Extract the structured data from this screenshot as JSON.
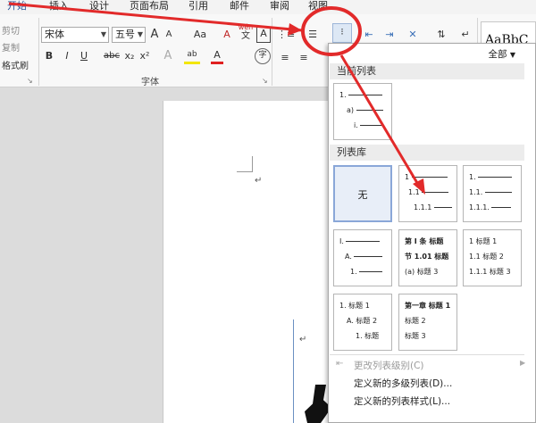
{
  "tabs": [
    "开始",
    "插入",
    "设计",
    "页面布局",
    "引用",
    "邮件",
    "审阅",
    "视图"
  ],
  "clipboard": {
    "cut": "剪切",
    "copy": "复制",
    "format_painter": "格式刷"
  },
  "font": {
    "name": "宋体",
    "size": "五号",
    "grow": "A",
    "shrink": "A",
    "case": "Aa",
    "clear": "A",
    "pinyin_top": "wén",
    "pinyin_bottom": "文",
    "border": "A",
    "bold": "B",
    "italic": "I",
    "underline": "U",
    "strike": "abc",
    "sub": "x₂",
    "sup": "x²",
    "effects": "A",
    "highlight": "ab",
    "color": "A",
    "enclose": "字",
    "group_label": "字体"
  },
  "style_preview": "AaBbC",
  "accent": "#e22a2a",
  "dropdown": {
    "filter": "全部",
    "current_header": "当前列表",
    "current_rows": [
      "1.",
      "a)",
      "i."
    ],
    "library_header": "列表库",
    "none_label": "无",
    "tiles": [
      {
        "rows": [
          "1",
          "1.1",
          "1.1.1"
        ]
      },
      {
        "rows": [
          "1.",
          "1.1.",
          "1.1.1."
        ]
      },
      {
        "rows": [
          "I.",
          "A.",
          "1."
        ]
      },
      {
        "rows": [
          "第 Ⅰ 条 标题",
          "节 1.01 标题",
          "(a) 标题 3"
        ]
      },
      {
        "rows": [
          "1 标题 1",
          "1.1 标题 2",
          "1.1.1 标题 3"
        ]
      },
      {
        "rows": [
          "1. 标题 1",
          "A. 标题 2",
          "1. 标题"
        ]
      },
      {
        "rows": [
          "第一章 标题 1",
          "标题 2",
          "标题 3"
        ]
      }
    ],
    "menu": [
      {
        "label": "更改列表级别(C)",
        "disabled": true
      },
      {
        "label": "定义新的多级列表(D)...",
        "disabled": false
      },
      {
        "label": "定义新的列表样式(L)...",
        "disabled": false
      }
    ]
  },
  "doc": {
    "mark1": "↵",
    "mark2": "↵"
  }
}
